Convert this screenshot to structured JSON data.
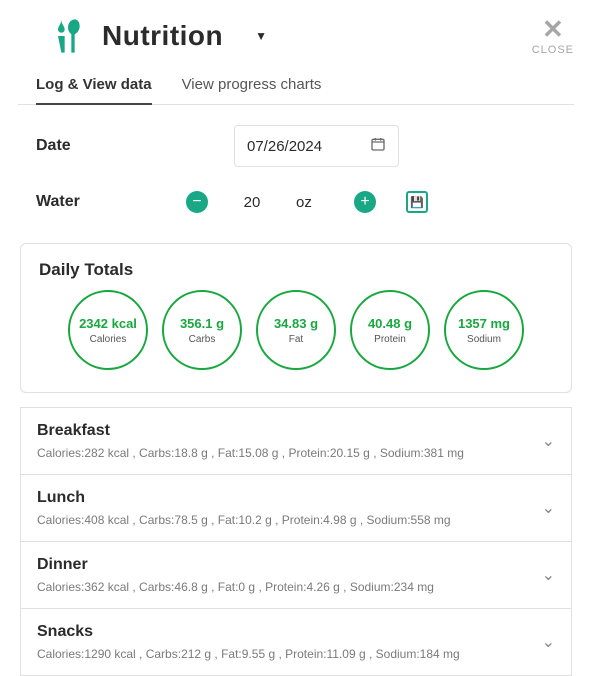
{
  "header": {
    "title": "Nutrition",
    "close_label": "CLOSE"
  },
  "tabs": {
    "log": "Log & View data",
    "charts": "View progress charts"
  },
  "date": {
    "label": "Date",
    "value": "07/26/2024"
  },
  "water": {
    "label": "Water",
    "value": "20",
    "unit": "oz"
  },
  "totals": {
    "heading": "Daily Totals",
    "items": [
      {
        "value": "2342 kcal",
        "label": "Calories"
      },
      {
        "value": "356.1 g",
        "label": "Carbs"
      },
      {
        "value": "34.83 g",
        "label": "Fat"
      },
      {
        "value": "40.48 g",
        "label": "Protein"
      },
      {
        "value": "1357 mg",
        "label": "Sodium"
      }
    ]
  },
  "meals": [
    {
      "name": "Breakfast",
      "summary": "Calories:282 kcal , Carbs:18.8 g , Fat:15.08 g , Protein:20.15 g , Sodium:381 mg"
    },
    {
      "name": "Lunch",
      "summary": "Calories:408 kcal , Carbs:78.5 g , Fat:10.2 g , Protein:4.98 g , Sodium:558 mg"
    },
    {
      "name": "Dinner",
      "summary": "Calories:362 kcal , Carbs:46.8 g , Fat:0 g , Protein:4.26 g , Sodium:234 mg"
    },
    {
      "name": "Snacks",
      "summary": "Calories:1290 kcal , Carbs:212 g , Fat:9.55 g , Protein:11.09 g , Sodium:184 mg"
    }
  ]
}
